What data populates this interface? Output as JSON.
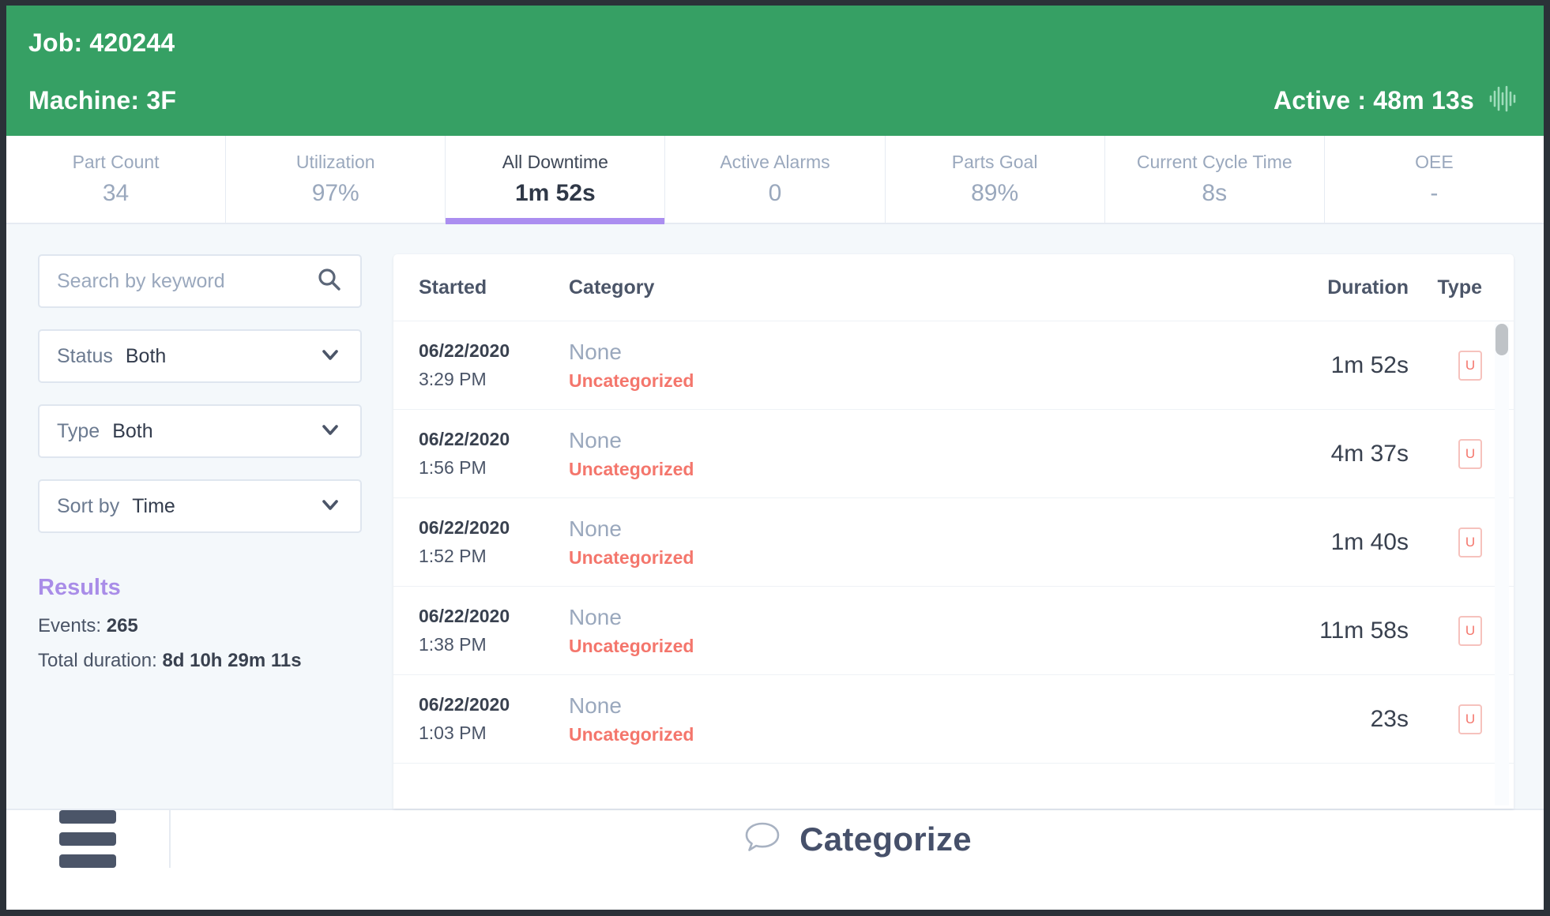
{
  "header": {
    "job_label": "Job: 420244",
    "machine_label": "Machine: 3F",
    "active_label": "Active : 48m 13s",
    "pulse_icon": "waveform-icon",
    "bg_color": "#36a064"
  },
  "kpis": [
    {
      "label": "Part Count",
      "value": "34",
      "active": false
    },
    {
      "label": "Utilization",
      "value": "97%",
      "active": false
    },
    {
      "label": "All Downtime",
      "value": "1m 52s",
      "active": true
    },
    {
      "label": "Active Alarms",
      "value": "0",
      "active": false
    },
    {
      "label": "Parts Goal",
      "value": "89%",
      "active": false
    },
    {
      "label": "Current Cycle Time",
      "value": "8s",
      "active": false
    },
    {
      "label": "OEE",
      "value": "-",
      "active": false
    }
  ],
  "filters": {
    "search_placeholder": "Search by keyword",
    "search_value": "",
    "search_icon": "search-icon",
    "status": {
      "label": "Status",
      "value": "Both"
    },
    "type": {
      "label": "Type",
      "value": "Both"
    },
    "sort": {
      "label": "Sort by",
      "value": "Time"
    },
    "chevron_icon": "chevron-down-icon"
  },
  "results": {
    "heading": "Results",
    "events_label": "Events:",
    "events_value": "265",
    "duration_label": "Total duration:",
    "duration_value": "8d 10h 29m 11s",
    "accent_color": "#a98de8"
  },
  "table": {
    "columns": {
      "started": "Started",
      "category": "Category",
      "duration": "Duration",
      "type": "Type"
    },
    "rows": [
      {
        "date": "06/22/2020",
        "time": "3:29 PM",
        "category": "None",
        "subcategory": "Uncategorized",
        "duration": "1m 52s",
        "type_badge": "U"
      },
      {
        "date": "06/22/2020",
        "time": "1:56 PM",
        "category": "None",
        "subcategory": "Uncategorized",
        "duration": "4m 37s",
        "type_badge": "U"
      },
      {
        "date": "06/22/2020",
        "time": "1:52 PM",
        "category": "None",
        "subcategory": "Uncategorized",
        "duration": "1m 40s",
        "type_badge": "U"
      },
      {
        "date": "06/22/2020",
        "time": "1:38 PM",
        "category": "None",
        "subcategory": "Uncategorized",
        "duration": "11m 58s",
        "type_badge": "U"
      },
      {
        "date": "06/22/2020",
        "time": "1:03 PM",
        "category": "None",
        "subcategory": "Uncategorized",
        "duration": "23s",
        "type_badge": "U"
      }
    ],
    "uncategorized_color": "#f4766c"
  },
  "bottom_bar": {
    "menu_icon": "hamburger-menu-icon",
    "categorize_icon": "comment-bubble-icon",
    "categorize_label": "Categorize"
  }
}
